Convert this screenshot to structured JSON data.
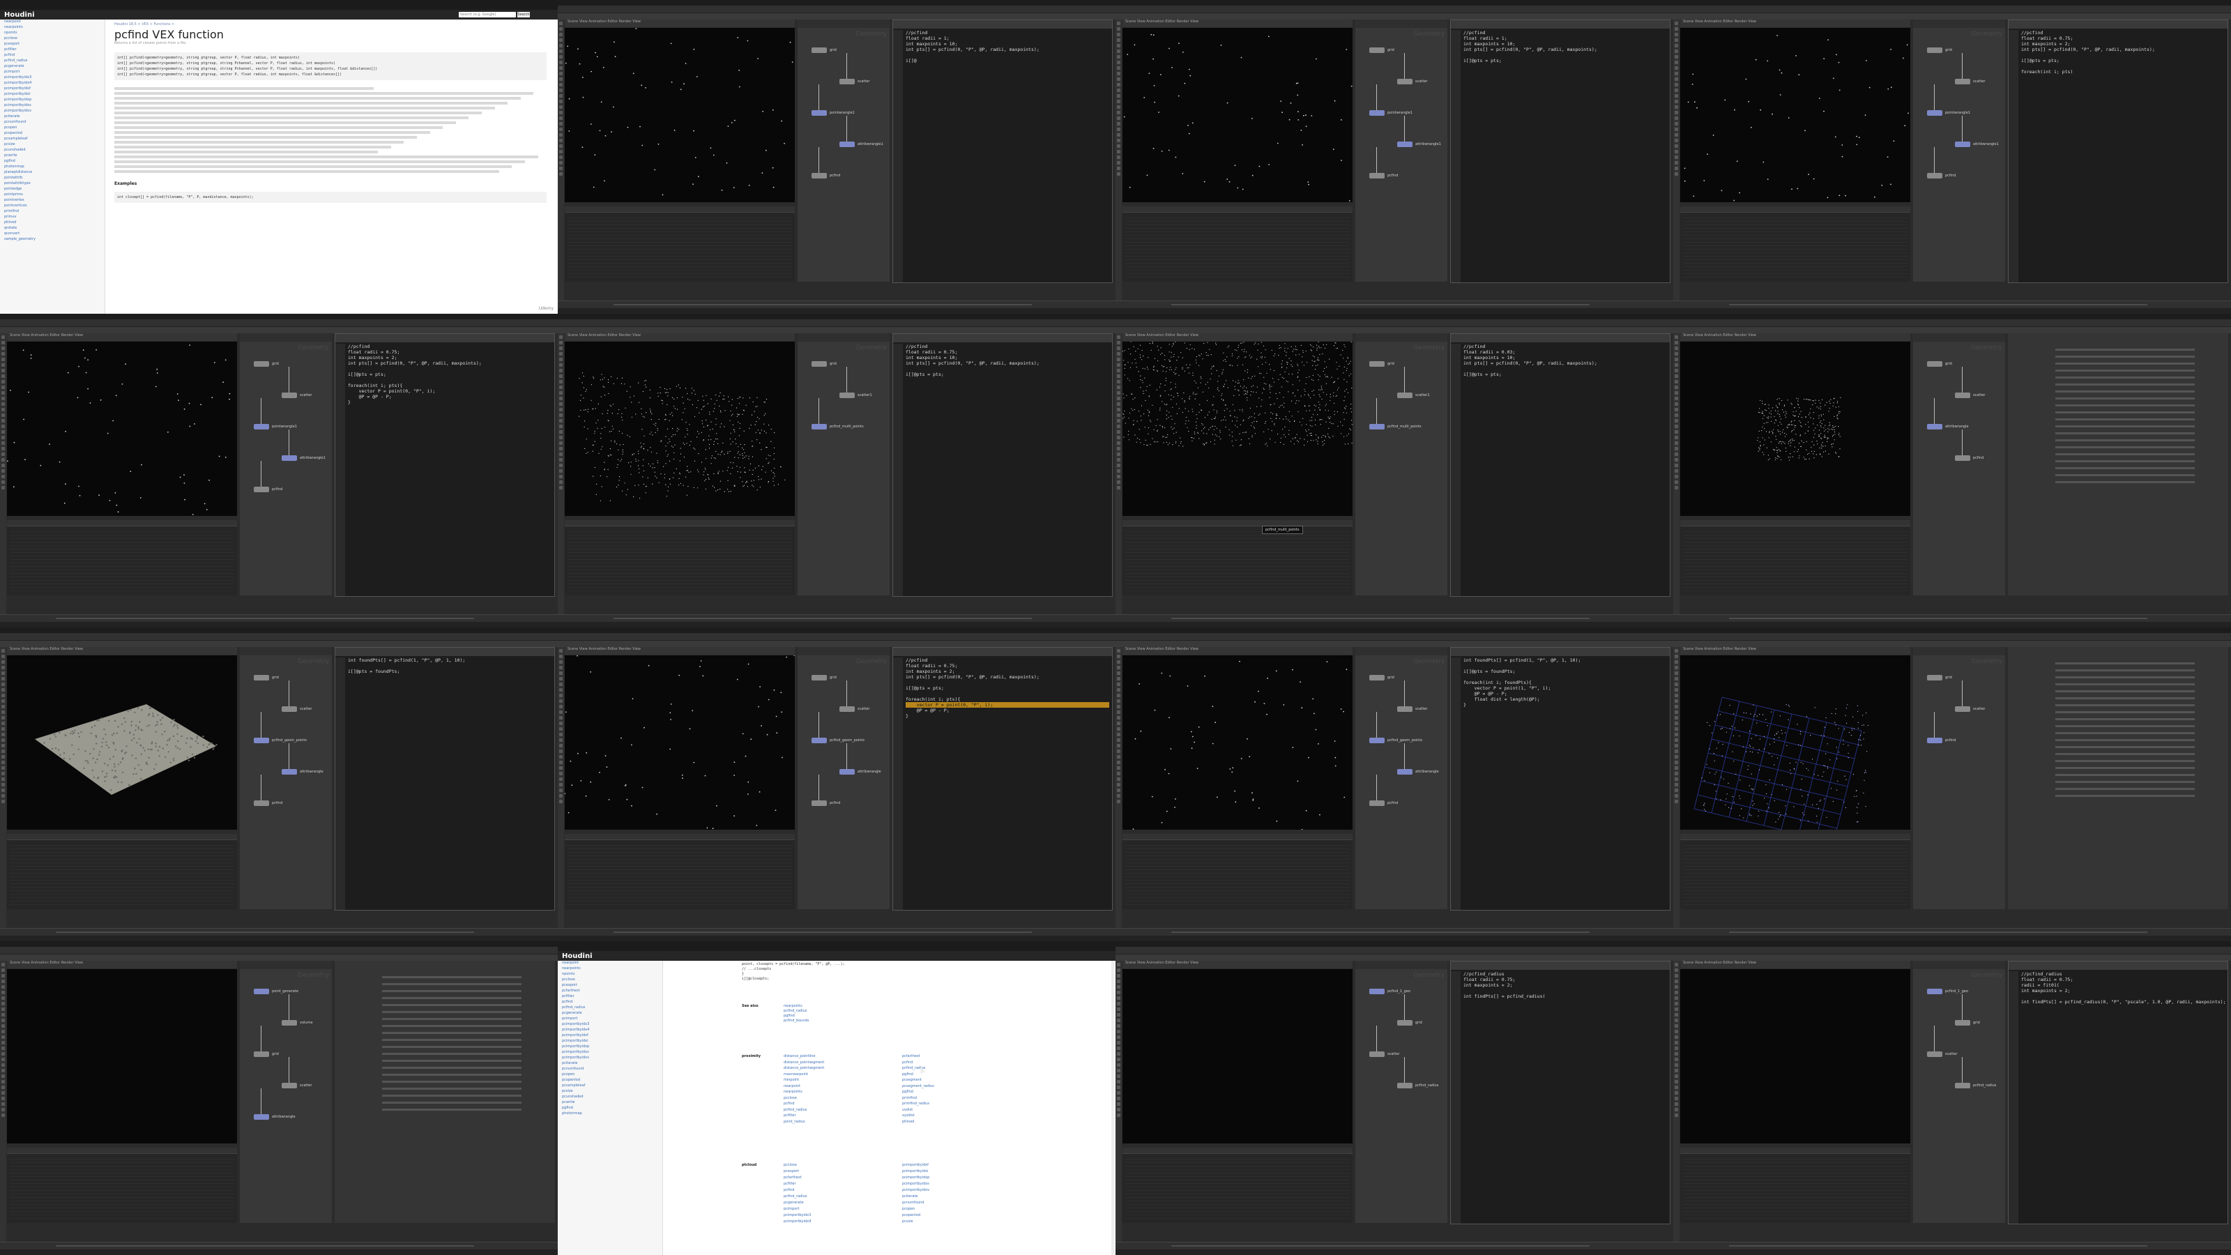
{
  "tiles": [
    {
      "kind": "doc",
      "site_logo": "Houdini",
      "search_placeholder": "Search (e.g. Google)",
      "search_button": "Search",
      "breadcrumb": "Houdini 18.5 > VEX > Functions >",
      "page_title": "pcfind VEX function",
      "subtitle": "Returns a list of closest points from a file.",
      "signatures": [
        "int[] pcfind(<geometry>geometry, string ptgroup, vector P, float radius, int maxpoints)",
        "int[] pcfind(<geometry>geometry, string ptgroup, string Pchannel, vector P, float radius, int maxpoints)",
        "int[] pcfind(<geometry>geometry, string ptgroup, string Pchannel, vector P, float radius, int maxpoints, float &distances[])",
        "int[] pcfind(<geometry>geometry, string ptgroup, vector P, float radius, int maxpoints, float &distances[])"
      ],
      "section_examples": "Examples",
      "example_line": "int closept[] = pcfind(filename, \"P\", P, maxdistance, maxpoints);",
      "sidebar": [
        "nearpoint",
        "nearpoints",
        "npoints",
        "pcclose",
        "pcexport",
        "pcfilter",
        "pcfind",
        "pcfind_radius",
        "pcgenerate",
        "pcimport",
        "pcimportbyidx3",
        "pcimportbyidx4",
        "pcimportbyidxf",
        "pcimportbyidxi",
        "pcimportbyidxp",
        "pcimportbyidxs",
        "pcimportbyidxv",
        "pciterate",
        "pcnumfound",
        "pcopen",
        "pcopenlod",
        "pcsampleleaf",
        "pcsize",
        "pcunshaded",
        "pcwrite",
        "pgfind",
        "photonmap",
        "planeptdistance",
        "pointattrib",
        "pointattribtype",
        "pointedge",
        "pointprims",
        "pointvertex",
        "pointvertices",
        "primfind",
        "primuv",
        "ptlined",
        "qrotate",
        "qconvert",
        "sample_geometry"
      ],
      "watermark": "Udemy"
    },
    {
      "kind": "app",
      "viewport": "dark-points",
      "nodes": [
        [
          "grid",
          "geo"
        ],
        [
          "scatter",
          "geo"
        ],
        [
          "pointwrangle1",
          "wrangle"
        ],
        [
          "attribwrangle1",
          "wrangle"
        ],
        [
          "pcfind",
          "geo"
        ]
      ],
      "code": [
        "//pcfind",
        "float radii = 1;",
        "int maxpoints = 10;",
        "int pts[] = pcfind(0, \"P\", @P, radii, maxpoints);",
        "",
        "i[]@"
      ],
      "watermark": "Geometry"
    },
    {
      "kind": "app",
      "viewport": "dark-points",
      "nodes": [
        [
          "grid",
          "geo"
        ],
        [
          "scatter",
          "geo"
        ],
        [
          "pointwrangle1",
          "wrangle"
        ],
        [
          "attribwrangle1",
          "wrangle"
        ],
        [
          "pcfind",
          "geo"
        ]
      ],
      "code": [
        "//pcfind",
        "float radii = 1;",
        "int maxpoints = 10;",
        "int pts[] = pcfind(0, \"P\", @P, radii, maxpoints);",
        "",
        "i[]@pts = pts;"
      ],
      "watermark": "Geometry"
    },
    {
      "kind": "app",
      "viewport": "dark-points",
      "nodes": [
        [
          "grid",
          "geo"
        ],
        [
          "scatter",
          "geo"
        ],
        [
          "pointwrangle1",
          "wrangle"
        ],
        [
          "attribwrangle1",
          "wrangle"
        ],
        [
          "pcfind",
          "geo"
        ]
      ],
      "code": [
        "//pcfind",
        "float radii = 0.75;",
        "int maxpoints = 2;",
        "int pts[] = pcfind(0, \"P\", @P, radii, maxpoints);",
        "",
        "i[]@pts = pts;",
        "",
        "foreach(int i; pts)"
      ],
      "watermark": "Geometry"
    },
    {
      "kind": "app",
      "viewport": "dark-points",
      "nodes": [
        [
          "grid",
          "geo"
        ],
        [
          "scatter",
          "geo"
        ],
        [
          "pointwrangle1",
          "wrangle"
        ],
        [
          "attribwrangle1",
          "wrangle"
        ],
        [
          "pcfind",
          "geo"
        ]
      ],
      "code": [
        "//pcfind",
        "float radii = 0.75;",
        "int maxpoints = 2;",
        "int pts[] = pcfind(0, \"P\", @P, radii, maxpoints);",
        "",
        "i[]@pts = pts;",
        "",
        "foreach(int i; pts){",
        "    vector P = point(0, \"P\", i);",
        "    @P = @P - P;",
        "}"
      ],
      "watermark": "Geometry"
    },
    {
      "kind": "app",
      "viewport": "grid-points",
      "nodes": [
        [
          "grid",
          "geo"
        ],
        [
          "scatter1",
          "geo"
        ],
        [
          "pcfind_multi_points",
          "wrangle"
        ]
      ],
      "code": [
        "//pcfind",
        "float radii = 0.75;",
        "int maxpoints = 10;",
        "int pts[] = pcfind(0, \"P\", @P, radii, maxpoints);",
        "",
        "i[]@pts = pts;"
      ],
      "watermark": "Geometry"
    },
    {
      "kind": "app",
      "viewport": "dense-points",
      "nodes": [
        [
          "grid",
          "geo"
        ],
        [
          "scatter1",
          "geo"
        ],
        [
          "pcfind_multi_points",
          "wrangle"
        ]
      ],
      "code": [
        "//pcfind",
        "float radii = 0.03;",
        "int maxpoints = 10;",
        "int pts[] = pcfind(0, \"P\", @P, radii, maxpoints);",
        "",
        "i[]@pts = pts;"
      ],
      "tooltip": "pcfind_multi_points",
      "watermark": "Geometry"
    },
    {
      "kind": "app",
      "viewport": "clustered-points",
      "nodes": [
        [
          "grid",
          "geo"
        ],
        [
          "scatter",
          "geo"
        ],
        [
          "attribwrangle",
          "wrangle"
        ],
        [
          "pcfind",
          "geo"
        ]
      ],
      "code": [],
      "params": true,
      "watermark": "Geometry"
    },
    {
      "kind": "app",
      "viewport": "heightfield",
      "nodes": [
        [
          "grid",
          "geo"
        ],
        [
          "scatter",
          "geo"
        ],
        [
          "pcfind_geom_points",
          "wrangle"
        ],
        [
          "attribwrangle",
          "wrangle"
        ],
        [
          "pcfind",
          "geo"
        ]
      ],
      "code": [
        "int foundPts[] = pcfind(1, \"P\", @P, 1, 10);",
        "",
        "i[]@pts = foundPts;"
      ],
      "watermark": "Geometry"
    },
    {
      "kind": "app",
      "viewport": "dark-points",
      "nodes": [
        [
          "grid",
          "geo"
        ],
        [
          "scatter",
          "geo"
        ],
        [
          "pcfind_geom_points",
          "wrangle"
        ],
        [
          "attribwrangle",
          "wrangle"
        ],
        [
          "pcfind",
          "geo"
        ]
      ],
      "code": [
        "//pcfind",
        "float radii = 0.75;",
        "int maxpoints = 2;",
        "int pts[] = pcfind(0, \"P\", @P, radii, maxpoints);",
        "",
        "i[]@pts = pts;",
        "",
        "foreach(int i; pts){",
        "    vector P = point(0, \"P\", i);",
        "    @P = @P - P;",
        "}"
      ],
      "highlight_line": 8,
      "watermark": "Geometry"
    },
    {
      "kind": "app",
      "viewport": "dark-points",
      "nodes": [
        [
          "grid",
          "geo"
        ],
        [
          "scatter",
          "geo"
        ],
        [
          "pcfind_geom_points",
          "wrangle"
        ],
        [
          "attribwrangle",
          "wrangle"
        ],
        [
          "pcfind",
          "geo"
        ]
      ],
      "code": [
        "int foundPts[] = pcfind(1, \"P\", @P, 1, 10);",
        "",
        "i[]@pts = foundPts;",
        "",
        "foreach(int i; foundPts){",
        "    vector P = point(1, \"P\", i);",
        "    @P = @P - P;",
        "    float dist = length(@P);",
        "}"
      ],
      "watermark": "Geometry"
    },
    {
      "kind": "app",
      "viewport": "blue-grid",
      "nodes": [
        [
          "grid",
          "geo"
        ],
        [
          "scatter",
          "geo"
        ],
        [
          "pcfind",
          "wrangle"
        ]
      ],
      "code": [],
      "params": true,
      "watermark": "Geometry"
    },
    {
      "kind": "app",
      "viewport": "empty",
      "nodes": [
        [
          "point_generate",
          "wrangle"
        ],
        [
          "volume",
          "geo"
        ],
        [
          "grid",
          "geo"
        ],
        [
          "scatter",
          "geo"
        ],
        [
          "attribwrangle",
          "wrangle"
        ]
      ],
      "code": [],
      "params": true,
      "watermark": "Geometry"
    },
    {
      "kind": "doc2",
      "site_logo": "Houdini",
      "code_snippet": [
        "point, closepts = pcfind(filename, \"P\", @P, ...);",
        "// ...closepts",
        "}",
        "i[]@closepts;"
      ],
      "see_also_label": "See also",
      "see_also": [
        "nearpoints",
        "pcfind_radius",
        "pgfind",
        "pcfind_bounds"
      ],
      "proximity_label": "proximity",
      "proximity_left": [
        "distance_pointline",
        "distance_pointsegment",
        "distance_pointsegment",
        "maxnearpoint",
        "minpoint",
        "nearpoint",
        "nearpoints",
        "pcclose",
        "pcfind",
        "pcfind_radius",
        "pcfilter",
        "point_radius"
      ],
      "proximity_right": [
        "pcfarthest",
        "pcfind",
        "pcfind_radius",
        "pgfind",
        "pcsegment",
        "pcsegment_radius",
        "pgfind",
        "primfind",
        "primfind_radius",
        "uvdist",
        "xyzdist",
        "ptlined"
      ],
      "ptcloud_label": "ptcloud",
      "ptcloud_left": [
        "pcclose",
        "pcexport",
        "pcfarthest",
        "pcfilter",
        "pcfind",
        "pcfind_radius",
        "pcgenerate",
        "pcimport",
        "pcimportbyidx3",
        "pcimportbyidx4"
      ],
      "ptcloud_right": [
        "pcimportbyidxf",
        "pcimportbyidxi",
        "pcimportbyidxp",
        "pcimportbyidxs",
        "pcimportbyidxv",
        "pciterate",
        "pcnumfound",
        "pcopen",
        "pcopenlod",
        "pcsize"
      ],
      "sidebar": [
        "nearpoint",
        "nearpoints",
        "npoints",
        "pcclose",
        "pcexport",
        "pcfarthest",
        "pcfilter",
        "pcfind",
        "pcfind_radius",
        "pcgenerate",
        "pcimport",
        "pcimportbyidx3",
        "pcimportbyidx4",
        "pcimportbyidxf",
        "pcimportbyidxi",
        "pcimportbyidxp",
        "pcimportbyidxs",
        "pcimportbyidxv",
        "pciterate",
        "pcnumfound",
        "pcopen",
        "pcopenlod",
        "pcsampleleaf",
        "pcsize",
        "pcunshaded",
        "pcwrite",
        "pgfind",
        "photonmap"
      ]
    },
    {
      "kind": "app",
      "viewport": "empty",
      "nodes": [
        [
          "pcfind_1_geo",
          "wrangle"
        ],
        [
          "grid",
          "geo"
        ],
        [
          "scatter",
          "geo"
        ],
        [
          "pcfind_radius",
          "geo"
        ]
      ],
      "code": [
        "//pcfind_radius",
        "float radii = 0.75;",
        "int maxpoints = 2;",
        "",
        "int findPts[] = pcfind_radius("
      ],
      "watermark": "Geometry"
    },
    {
      "kind": "app",
      "viewport": "empty",
      "nodes": [
        [
          "pcfind_1_geo",
          "wrangle"
        ],
        [
          "grid",
          "geo"
        ],
        [
          "scatter",
          "geo"
        ],
        [
          "pcfind_radius",
          "geo"
        ]
      ],
      "code": [
        "//pcfind_radius",
        "float radii = 0.75;",
        "radii = fit01(",
        "int maxpoints = 2;",
        "",
        "int findPts[] = pcfind_radius(0, \"P\", \"pscale\", 1.0, @P, radii, maxpoints);"
      ],
      "watermark": "Geometry"
    }
  ],
  "menu": [
    "File",
    "Edit",
    "Render",
    "Assets",
    "Windows",
    "Help"
  ],
  "viewport_tabs": "Scene View  Animation Editor  Render View",
  "colors": {
    "accent": "#b8861b",
    "node_geo": "#8a8a8a",
    "node_wrangle": "#7d88c8",
    "doc_link": "#3b6fb6"
  }
}
